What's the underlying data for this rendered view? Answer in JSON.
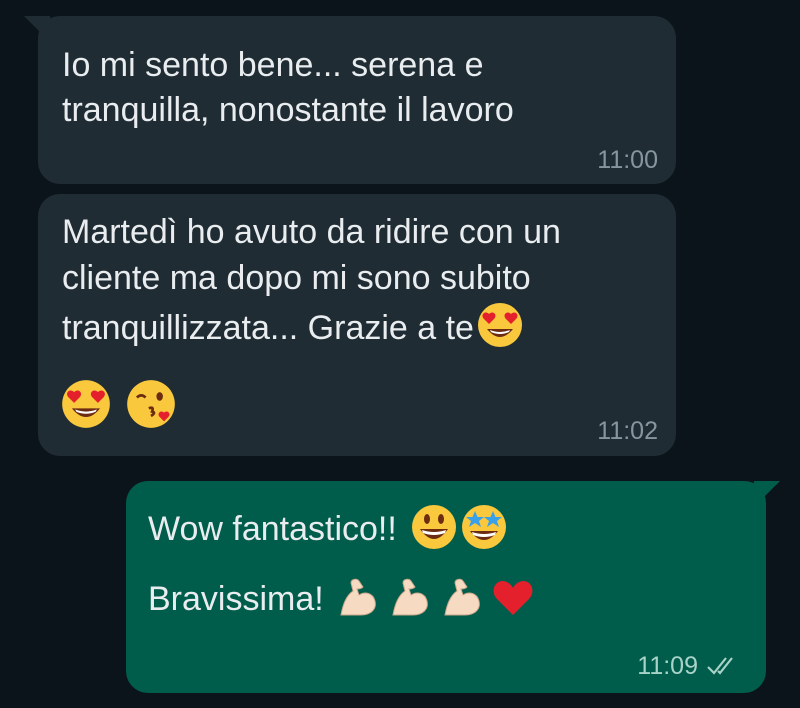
{
  "messages": [
    {
      "direction": "incoming",
      "text": "Io mi sento bene... serena e\ntranquilla, nonostante il lavoro",
      "time": "11:00"
    },
    {
      "direction": "incoming",
      "text_line1": "Martedì ho avuto da ridire con un",
      "text_line2": "cliente ma dopo mi sono subito",
      "text_line3": "tranquillizzata... Grazie a te",
      "time": "11:02",
      "emojis": [
        "heart-eyes-emoji",
        "heart-eyes-emoji",
        "kissing-wink-emoji"
      ]
    },
    {
      "direction": "outgoing",
      "text_line1": "Wow fantastico!!",
      "text_line2": "Bravissima!",
      "time": "11:09",
      "status": "read-double-check",
      "emojis": [
        "grinning-emoji",
        "star-struck-emoji",
        "flexed-biceps-emoji",
        "flexed-biceps-emoji",
        "flexed-biceps-emoji",
        "red-heart-emoji"
      ]
    }
  ],
  "colors": {
    "background": "#0b141a",
    "incoming_bubble": "#1f2c33",
    "outgoing_bubble": "#005c4b",
    "text": "#e9edef",
    "timestamp": "#8696a0"
  }
}
